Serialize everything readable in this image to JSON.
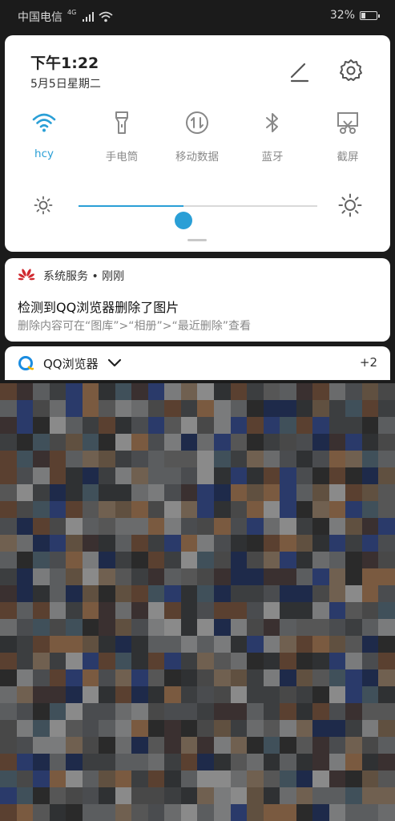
{
  "status_bar": {
    "carrier": "中国电信",
    "network": "4G",
    "battery_text": "32%",
    "battery_level": 0.32
  },
  "quick_panel": {
    "time": "下午1:22",
    "date": "5月5日星期二",
    "toggles": [
      {
        "label": "hcy",
        "icon": "wifi-icon",
        "active": true
      },
      {
        "label": "手电筒",
        "icon": "flashlight-icon",
        "active": false
      },
      {
        "label": "移动数据",
        "icon": "mobile-data-icon",
        "active": false
      },
      {
        "label": "蓝牙",
        "icon": "bluetooth-icon",
        "active": false
      },
      {
        "label": "截屏",
        "icon": "screenshot-icon",
        "active": false
      }
    ],
    "brightness_level": 0.44,
    "accent_color": "#2a9fd6"
  },
  "notification": {
    "app": "系统服务 • 刚刚",
    "title": "检测到QQ浏览器删除了图片",
    "body": "删除内容可在“图库”>“相册”>“最近删除”查看"
  },
  "notification2": {
    "app": "QQ浏览器",
    "count": "+2"
  },
  "background": {
    "colors": [
      "#4a4c4f",
      "#2f3133",
      "#5b5d5f",
      "#6a6b6c",
      "#3c3e40",
      "#7a7b7c",
      "#1e2a4a",
      "#2a3a6a",
      "#5a4030",
      "#7a5a40",
      "#3a3030",
      "#8a8a8a",
      "#565656",
      "#2a2a2a",
      "#706050",
      "#40505a",
      "#605040",
      "#484848"
    ]
  }
}
